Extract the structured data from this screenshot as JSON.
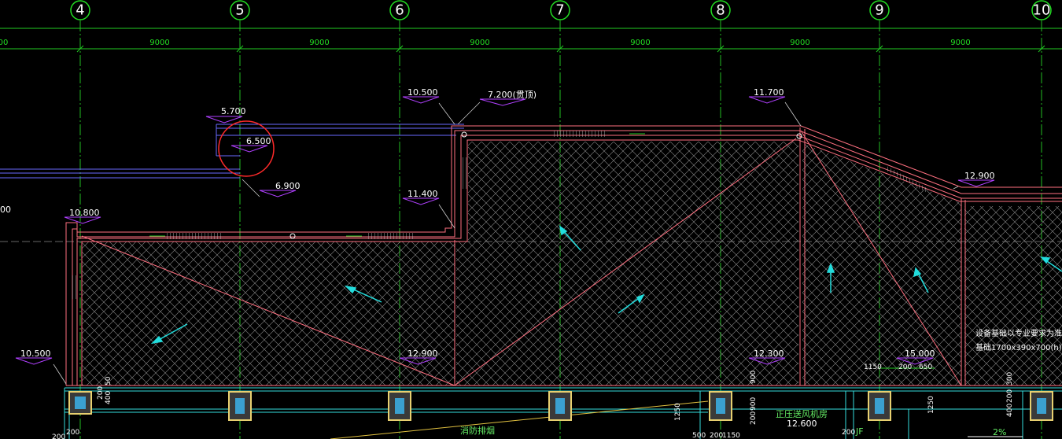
{
  "colors": {
    "background": "#000000",
    "grid_line": "#22cc22",
    "grid_bubble": "#22dd22",
    "wall": "#ff7080",
    "hatch": "#9a9a9a",
    "elev_marker": "#b040ff",
    "column": "#e8d070",
    "column_fill": "#3aa0d0",
    "beam": "#33dddd",
    "arrow": "#22dddd",
    "blue_line": "#6a6aff",
    "highlight_circle": "#ff2a2a"
  },
  "grid": {
    "axes": [
      {
        "label": "4"
      },
      {
        "label": "5"
      },
      {
        "label": "6"
      },
      {
        "label": "7"
      },
      {
        "label": "8"
      },
      {
        "label": "9"
      },
      {
        "label": "10"
      }
    ],
    "spans": [
      "9000",
      "9000",
      "9000",
      "9000",
      "9000",
      "9000"
    ],
    "left_partial": "00"
  },
  "elevations": {
    "e1": "5.700",
    "e2": "6.500",
    "e3": "6.900",
    "e4": "10.500",
    "e5": "7.200(贯顶)",
    "e6": "11.700",
    "e7": "11.400",
    "e8": "10.800",
    "e9": "12.900",
    "e10": "10.500",
    "e11": "12.900",
    "e12": "12.300",
    "e13": "15.000",
    "e14": "12.600",
    "left_partial": "00"
  },
  "notes": {
    "equip_1": "设备基础以专业要求为准",
    "equip_2": "基础1700x390x700(h)",
    "room_fan": "正压送风机房",
    "room_fire": "消防排烟",
    "slope": "2%",
    "jf": "JF"
  },
  "dims": {
    "d1150a": "1150",
    "d200a": "200",
    "d650": "650",
    "d200_v1": "200",
    "d400_v1": "400",
    "d50_v1": "50",
    "d900": "900",
    "d1250a": "1250",
    "d1250b": "1250",
    "d200_v2": "200",
    "d900_v2": "900",
    "d200_v3": "200",
    "d400_v3": "400",
    "d300_v3": "300",
    "d200_b1": "200",
    "d200_b2": "200",
    "d500": "500",
    "d200_b3": "200",
    "d1150b": "1150",
    "d200_b4": "200"
  }
}
